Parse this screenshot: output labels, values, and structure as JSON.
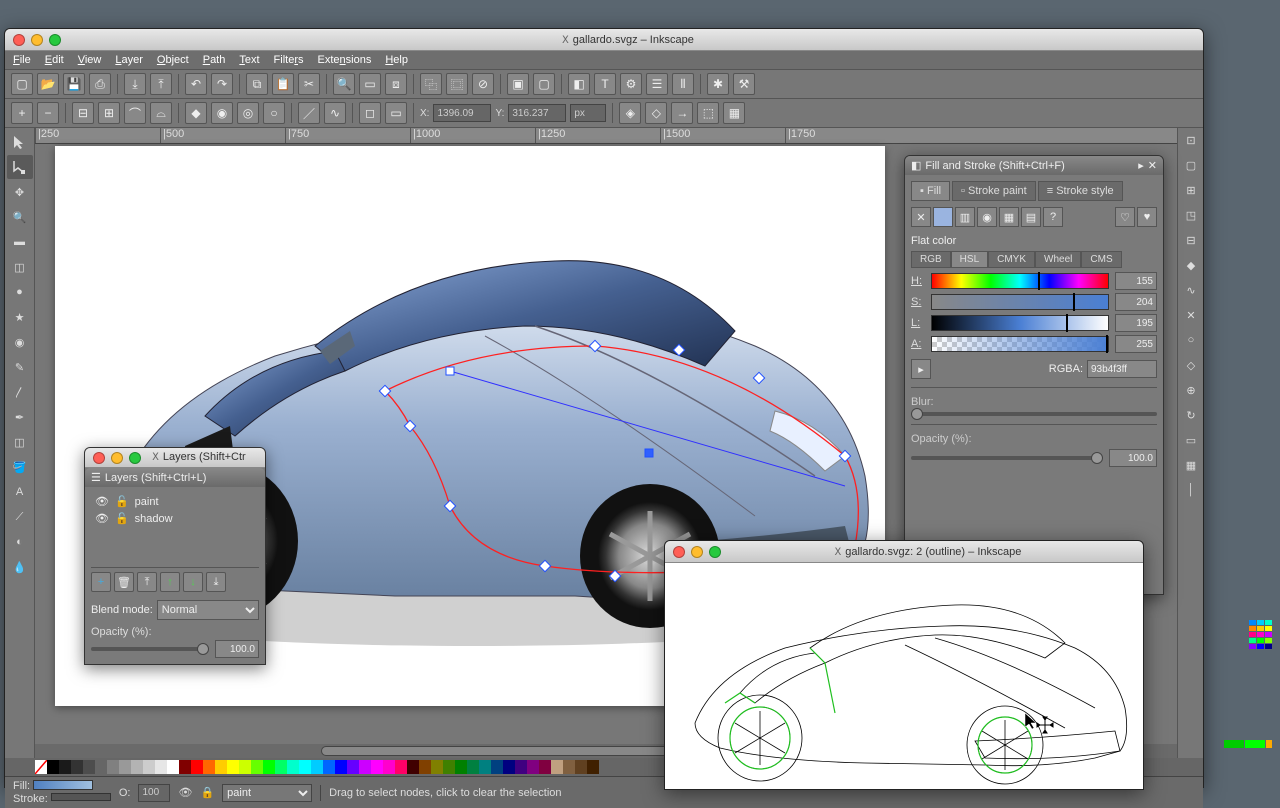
{
  "main_window": {
    "title": "gallardo.svgz – Inkscape",
    "menus": [
      "File",
      "Edit",
      "View",
      "Layer",
      "Object",
      "Path",
      "Text",
      "Filters",
      "Extensions",
      "Help"
    ],
    "coord_x_label": "X:",
    "coord_x": "1396.09",
    "coord_y_label": "Y:",
    "coord_y": "316.237",
    "coord_unit": "px",
    "ruler_marks": [
      "|250",
      "|500",
      "|750",
      "|1000",
      "|1250",
      "|1500",
      "|1750"
    ]
  },
  "fill_stroke": {
    "title": "Fill and Stroke (Shift+Ctrl+F)",
    "tabs": [
      "Fill",
      "Stroke paint",
      "Stroke style"
    ],
    "active_tab": "Fill",
    "paint_mode": "Flat color",
    "color_tabs": [
      "RGB",
      "HSL",
      "CMYK",
      "Wheel",
      "CMS"
    ],
    "active_color_tab": "HSL",
    "h_label": "H:",
    "h_value": "155",
    "s_label": "S:",
    "s_value": "204",
    "l_label": "L:",
    "l_value": "195",
    "a_label": "A:",
    "a_value": "255",
    "rgba_label": "RGBA:",
    "rgba_value": "93b4f3ff",
    "blur_label": "Blur:",
    "opacity_label": "Opacity (%):",
    "opacity_value": "100.0"
  },
  "layers": {
    "title": "Layers (Shift+Ctrl+L)",
    "short_title": "Layers (Shift+Ctr",
    "items": [
      "paint",
      "shadow"
    ],
    "blend_label": "Blend mode:",
    "blend_value": "Normal",
    "opacity_label": "Opacity (%):",
    "opacity_value": "100.0"
  },
  "outline_window": {
    "title": "gallardo.svgz: 2 (outline) – Inkscape"
  },
  "statusbar": {
    "fill_label": "Fill:",
    "stroke_label": "Stroke:",
    "opacity_label": "O:",
    "opacity_value": "100",
    "layer_value": "paint",
    "hint": "Drag to select nodes, click to clear the selection"
  },
  "palette": [
    "#000000",
    "#1a1a1a",
    "#333333",
    "#4d4d4d",
    "#666666",
    "#808080",
    "#999999",
    "#b3b3b3",
    "#cccccc",
    "#e6e6e6",
    "#ffffff",
    "#800000",
    "#ff0000",
    "#ff6600",
    "#ffcc00",
    "#ffff00",
    "#ccff00",
    "#66ff00",
    "#00ff00",
    "#00ff66",
    "#00ffcc",
    "#00ffff",
    "#00ccff",
    "#0066ff",
    "#0000ff",
    "#6600ff",
    "#cc00ff",
    "#ff00ff",
    "#ff00cc",
    "#ff0066",
    "#400000",
    "#804000",
    "#808000",
    "#408000",
    "#008000",
    "#008040",
    "#008080",
    "#004080",
    "#000080",
    "#400080",
    "#800080",
    "#800040",
    "#c0a080",
    "#806040",
    "#604020",
    "#402000"
  ]
}
